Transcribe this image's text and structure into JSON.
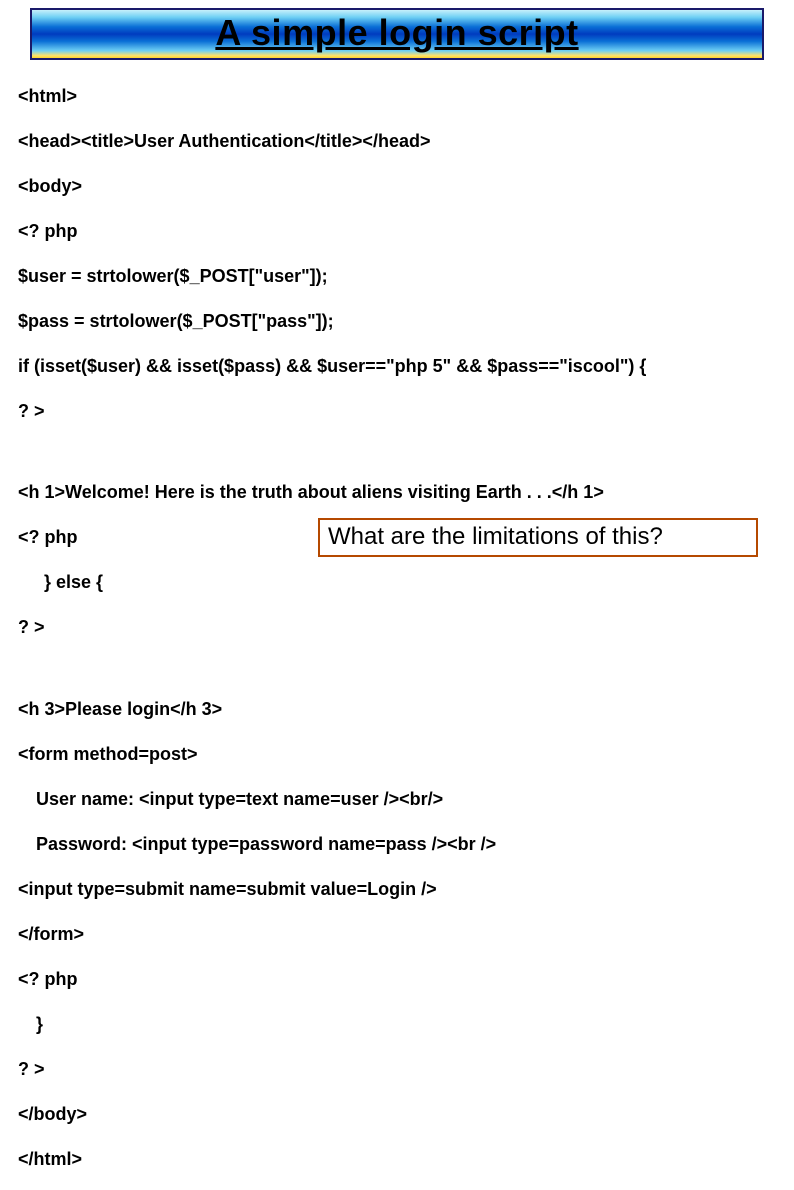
{
  "title": "A simple login script",
  "code": {
    "l01": "<html>",
    "l02": "<head><title>User Authentication</title></head>",
    "l03": "<body>",
    "l04": "<? php",
    "l05": "$user = strtolower($_POST[\"user\"]);",
    "l06": "$pass = strtolower($_POST[\"pass\"]);",
    "l07": "if (isset($user) && isset($pass) && $user==\"php 5\" && $pass==\"iscool\") {",
    "l08": "? >",
    "l09": "<h 1>Welcome! Here is the truth about aliens visiting Earth . . .</h 1>",
    "l10": "<? php",
    "l11": "} else {",
    "l12": "? >",
    "l13": "<h 3>Please login</h 3>",
    "l14": "<form method=post>",
    "l15": "User name: <input type=text name=user /><br/>",
    "l16": "Password: <input type=password name=pass /><br />",
    "l17": "<input type=submit name=submit value=Login />",
    "l18": "</form>",
    "l19": "<? php",
    "l20": "}",
    "l21": "? >",
    "l22": "</body>",
    "l23": "</html>"
  },
  "callout": "What are the limitations of this?"
}
